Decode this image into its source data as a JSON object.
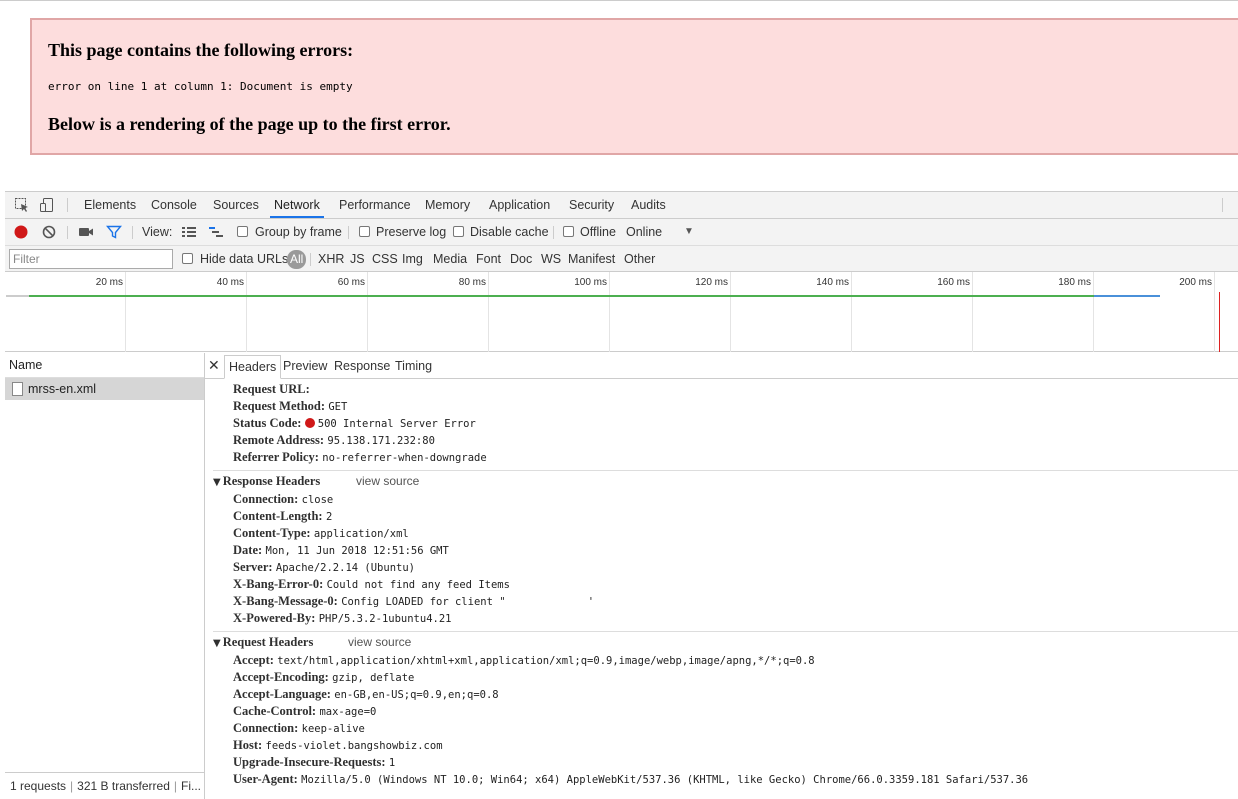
{
  "error_page": {
    "title": "This page contains the following errors:",
    "message": "error on line 1 at column 1: Document is empty",
    "footer": "Below is a rendering of the page up to the first error."
  },
  "devtools": {
    "panel_tabs": [
      "Elements",
      "Console",
      "Sources",
      "Network",
      "Performance",
      "Memory",
      "Application",
      "Security",
      "Audits"
    ],
    "active_panel": "Network",
    "toolbar": {
      "view_label": "View:",
      "group_by_frame": "Group by frame",
      "preserve_log": "Preserve log",
      "disable_cache": "Disable cache",
      "offline": "Offline",
      "throttling": "Online"
    },
    "filter": {
      "placeholder": "Filter",
      "hide_data_urls": "Hide data URLs",
      "types": [
        "All",
        "XHR",
        "JS",
        "CSS",
        "Img",
        "Media",
        "Font",
        "Doc",
        "WS",
        "Manifest",
        "Other"
      ]
    },
    "timeline_ticks": [
      "20 ms",
      "40 ms",
      "60 ms",
      "80 ms",
      "100 ms",
      "120 ms",
      "140 ms",
      "160 ms",
      "180 ms",
      "200 ms"
    ],
    "request_list": {
      "header": "Name",
      "requests": [
        "mrss-en.xml"
      ],
      "status": {
        "requests": "1 requests",
        "transferred": "321 B transferred",
        "more": "Fi..."
      }
    },
    "details": {
      "tabs": [
        "Headers",
        "Preview",
        "Response",
        "Timing"
      ],
      "active_tab": "Headers",
      "general": [
        {
          "key": "Request URL:",
          "value": ""
        },
        {
          "key": "Request Method:",
          "value": "GET"
        },
        {
          "key": "Status Code:",
          "value": "500 Internal Server Error"
        },
        {
          "key": "Remote Address:",
          "value": "95.138.171.232:80"
        },
        {
          "key": "Referrer Policy:",
          "value": "no-referrer-when-downgrade"
        }
      ],
      "response_headers": {
        "title": "Response Headers",
        "view_source": "view source",
        "items": [
          {
            "key": "Connection:",
            "value": "close"
          },
          {
            "key": "Content-Length:",
            "value": "2"
          },
          {
            "key": "Content-Type:",
            "value": "application/xml"
          },
          {
            "key": "Date:",
            "value": "Mon, 11 Jun 2018 12:51:56 GMT"
          },
          {
            "key": "Server:",
            "value": "Apache/2.2.14 (Ubuntu)"
          },
          {
            "key": "X-Bang-Error-0:",
            "value": "Could not find any feed Items"
          },
          {
            "key": "X-Bang-Message-0:",
            "value": "Config LOADED for client \"             '"
          },
          {
            "key": "X-Powered-By:",
            "value": "PHP/5.3.2-1ubuntu4.21"
          }
        ]
      },
      "request_headers": {
        "title": "Request Headers",
        "view_source": "view source",
        "items": [
          {
            "key": "Accept:",
            "value": "text/html,application/xhtml+xml,application/xml;q=0.9,image/webp,image/apng,*/*;q=0.8"
          },
          {
            "key": "Accept-Encoding:",
            "value": "gzip, deflate"
          },
          {
            "key": "Accept-Language:",
            "value": "en-GB,en-US;q=0.9,en;q=0.8"
          },
          {
            "key": "Cache-Control:",
            "value": "max-age=0"
          },
          {
            "key": "Connection:",
            "value": "keep-alive"
          },
          {
            "key": "Host:",
            "value": "feeds-violet.bangshowbiz.com"
          },
          {
            "key": "Upgrade-Insecure-Requests:",
            "value": "1"
          },
          {
            "key": "User-Agent:",
            "value": "Mozilla/5.0 (Windows NT 10.0; Win64; x64) AppleWebKit/537.36 (KHTML, like Gecko) Chrome/66.0.3359.181 Safari/537.36"
          }
        ]
      }
    },
    "colors": {
      "error_bg": "#fddddd",
      "error_border": "#e0a6a6",
      "record_red": "#d01818",
      "status_red": "#d01818",
      "waterfall_green": "#4caf50",
      "waterfall_blue": "#4a90d9",
      "active_tab_blue": "#1a73e8"
    }
  }
}
